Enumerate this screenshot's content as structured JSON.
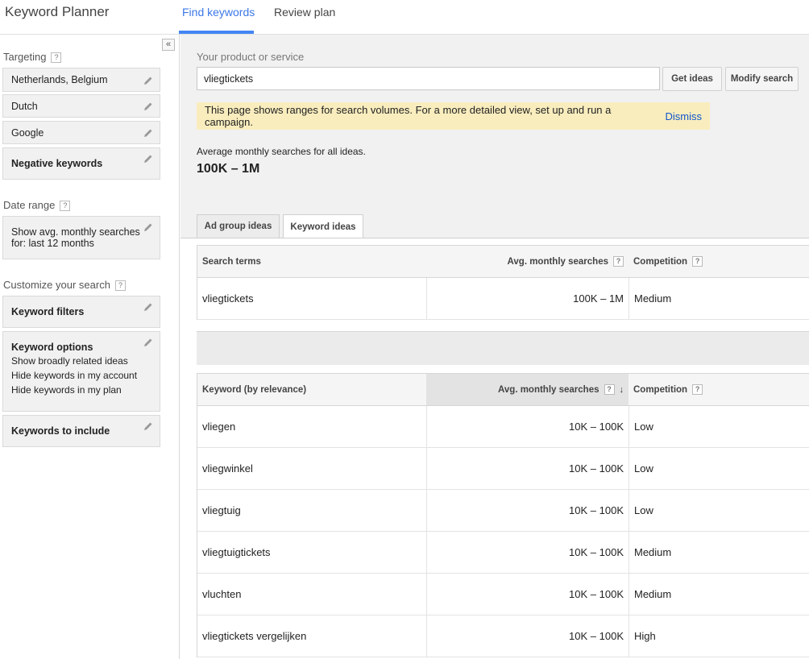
{
  "header": {
    "app_title": "Keyword Planner",
    "tabs": [
      {
        "label": "Find keywords",
        "active": true
      },
      {
        "label": "Review plan",
        "active": false
      }
    ]
  },
  "sidebar": {
    "collapse_glyph": "«",
    "targeting_label": "Targeting",
    "targeting_items": [
      "Netherlands, Belgium",
      "Dutch",
      "Google",
      "Negative keywords"
    ],
    "date_range_label": "Date range",
    "date_range_lines": [
      "Show avg. monthly searches",
      "for: last 12 months"
    ],
    "customize_label": "Customize your search",
    "keyword_filters": "Keyword filters",
    "keyword_options": {
      "title": "Keyword options",
      "lines": [
        "Show broadly related ideas",
        "Hide keywords in my account",
        "Hide keywords in my plan"
      ]
    },
    "keywords_to_include": "Keywords to include"
  },
  "search": {
    "label": "Your product or service",
    "value": "vliegtickets",
    "get_ideas": "Get ideas",
    "modify_search": "Modify search"
  },
  "notice": {
    "text": "This page shows ranges for search volumes. For a more detailed view, set up and run a campaign.",
    "dismiss": "Dismiss"
  },
  "summary": {
    "label": "Average monthly searches for all ideas.",
    "value": "100K – 1M"
  },
  "result_tabs": [
    {
      "label": "Ad group ideas",
      "active": false
    },
    {
      "label": "Keyword ideas",
      "active": true
    }
  ],
  "search_terms_table": {
    "headers": {
      "term": "Search terms",
      "avg": "Avg. monthly searches",
      "competition": "Competition"
    },
    "rows": [
      {
        "term": "vliegtickets",
        "avg": "100K – 1M",
        "competition": "Medium"
      }
    ]
  },
  "keyword_table": {
    "headers": {
      "term": "Keyword (by relevance)",
      "avg": "Avg. monthly searches",
      "competition": "Competition",
      "sort_glyph": "↓"
    },
    "rows": [
      {
        "term": "vliegen",
        "avg": "10K – 100K",
        "competition": "Low"
      },
      {
        "term": "vliegwinkel",
        "avg": "10K – 100K",
        "competition": "Low"
      },
      {
        "term": "vliegtuig",
        "avg": "10K – 100K",
        "competition": "Low"
      },
      {
        "term": "vliegtuigtickets",
        "avg": "10K – 100K",
        "competition": "Medium"
      },
      {
        "term": "vluchten",
        "avg": "10K – 100K",
        "competition": "Medium"
      },
      {
        "term": "vliegtickets vergelijken",
        "avg": "10K – 100K",
        "competition": "High"
      }
    ]
  },
  "help_glyph": "?",
  "colors": {
    "accent": "#4285f4",
    "notice_bg": "#f9edbe",
    "link": "#1155cc"
  }
}
